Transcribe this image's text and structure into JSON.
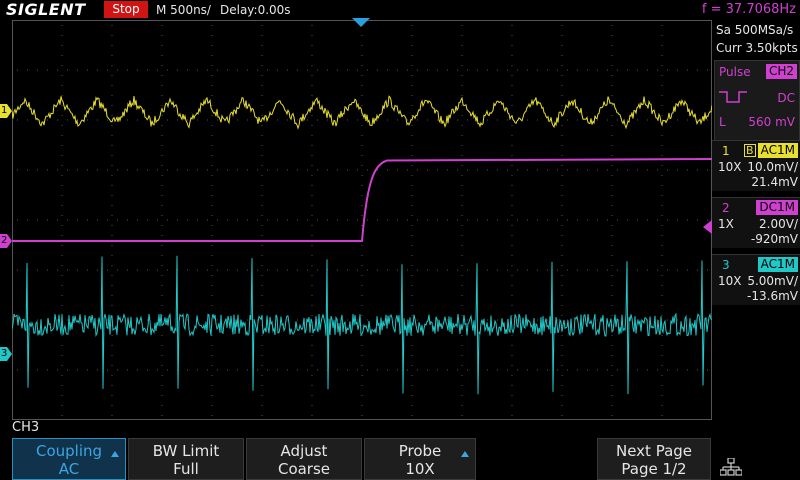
{
  "header": {
    "brand": "SIGLENT",
    "run_state": "Stop",
    "timebase": "M 500ns/",
    "delay": "Delay:0.00s",
    "frequency": "f = 37.7068Hz"
  },
  "acquisition": {
    "sample_rate": "Sa 500MSa/s",
    "memory": "Curr 3.50kpts"
  },
  "trigger": {
    "type": "Pulse",
    "source": "CH2",
    "coupling": "DC",
    "level_label": "L",
    "level": "560 mV"
  },
  "channels": [
    {
      "number": "1",
      "bw": "B",
      "coupling": "AC1M",
      "probe": "10X",
      "scale": "10.0mV/",
      "offset": "21.4mV",
      "color": "#e8e030",
      "marker": "1"
    },
    {
      "number": "2",
      "bw": "",
      "coupling": "DC1M",
      "probe": "1X",
      "scale": "2.00V/",
      "offset": "-920mV",
      "color": "#d040d0",
      "marker": "2"
    },
    {
      "number": "3",
      "bw": "",
      "coupling": "AC1M",
      "probe": "10X",
      "scale": "5.00mV/",
      "offset": "-13.6mV",
      "color": "#20c8c8",
      "marker": "3"
    }
  ],
  "menu": {
    "title": "CH3",
    "softkeys": [
      {
        "label": "Coupling",
        "value": "AC"
      },
      {
        "label": "BW Limit",
        "value": "Full"
      },
      {
        "label": "Adjust",
        "value": "Coarse"
      },
      {
        "label": "Probe",
        "value": "10X"
      },
      {
        "label": "Next Page",
        "value": "Page 1/2"
      }
    ]
  },
  "icons": {
    "trigger_position": "triangle-down-icon",
    "network": "network-icon"
  }
}
